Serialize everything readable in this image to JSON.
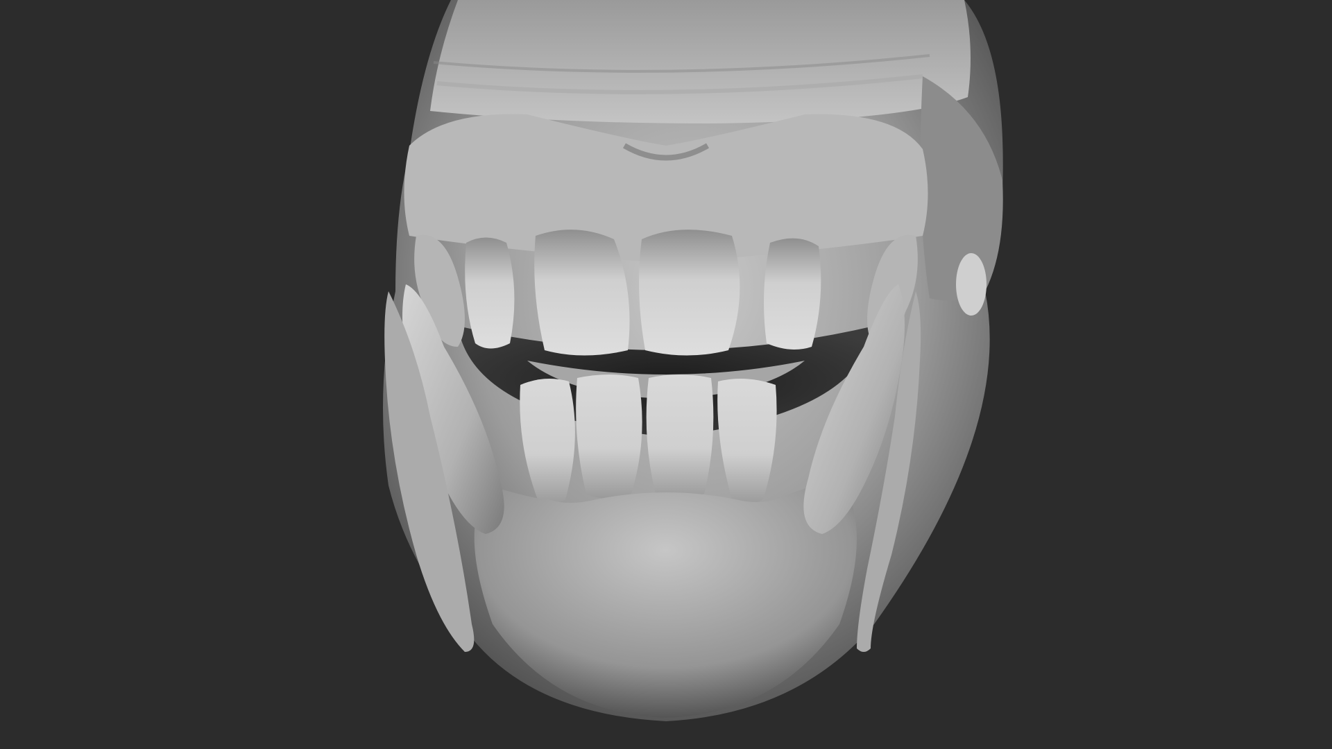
{
  "viewport": {
    "background_color": "#2c2c2c",
    "material_color": "#b9b9b9",
    "subject": "clay-sculpt-creature-jaw"
  },
  "sculpt": {
    "upper_incisors": 4,
    "lower_incisors": 4,
    "tusks": 2,
    "side_teeth": 2
  }
}
